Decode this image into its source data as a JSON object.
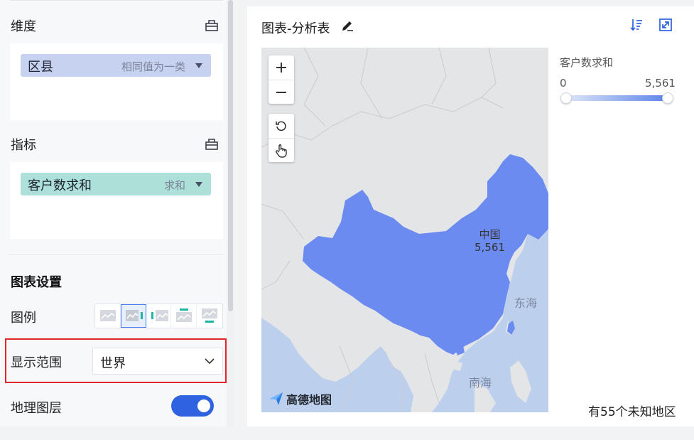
{
  "left_panel": {
    "dimension": {
      "title": "维度",
      "icon": "clear-box-icon",
      "pill": {
        "label": "区县",
        "aggregation": "相同值为一类"
      }
    },
    "metric": {
      "title": "指标",
      "icon": "clear-box-icon",
      "pill": {
        "label": "客户数求和",
        "aggregation": "求和"
      }
    },
    "chart_settings": {
      "title": "图表设置",
      "legend": {
        "label": "图例",
        "options": [
          "legend-none-icon",
          "legend-right-icon",
          "legend-left-icon",
          "legend-top-icon",
          "legend-bottom-icon"
        ],
        "selected_index": 1
      },
      "display_range": {
        "label": "显示范围",
        "value": "世界"
      },
      "geo_layer": {
        "label": "地理图层",
        "enabled": true
      }
    }
  },
  "chart_card": {
    "title": "图表-分析表",
    "icons": [
      "edit-icon",
      "sort-icon",
      "expand-icon"
    ],
    "map": {
      "controls": [
        "zoom-in-icon",
        "zoom-out-icon",
        "reset-icon",
        "hand-pan-icon"
      ],
      "region_label": "中国",
      "region_value": "5,561",
      "seas": [
        "东海",
        "南海"
      ],
      "provider": "高德地图"
    },
    "legend": {
      "title": "客户数求和",
      "min": "0",
      "max": "5,561"
    },
    "unknown_note": "有55个未知地区"
  },
  "colors": {
    "accent": "#2e62e0",
    "region_fill": "#6b8bf0",
    "land": "#e4e5e7",
    "sea": "#bccfec",
    "dimension_pill": "#c6d2f0",
    "metric_pill": "#ade0d8",
    "highlight": "#e0252b"
  }
}
